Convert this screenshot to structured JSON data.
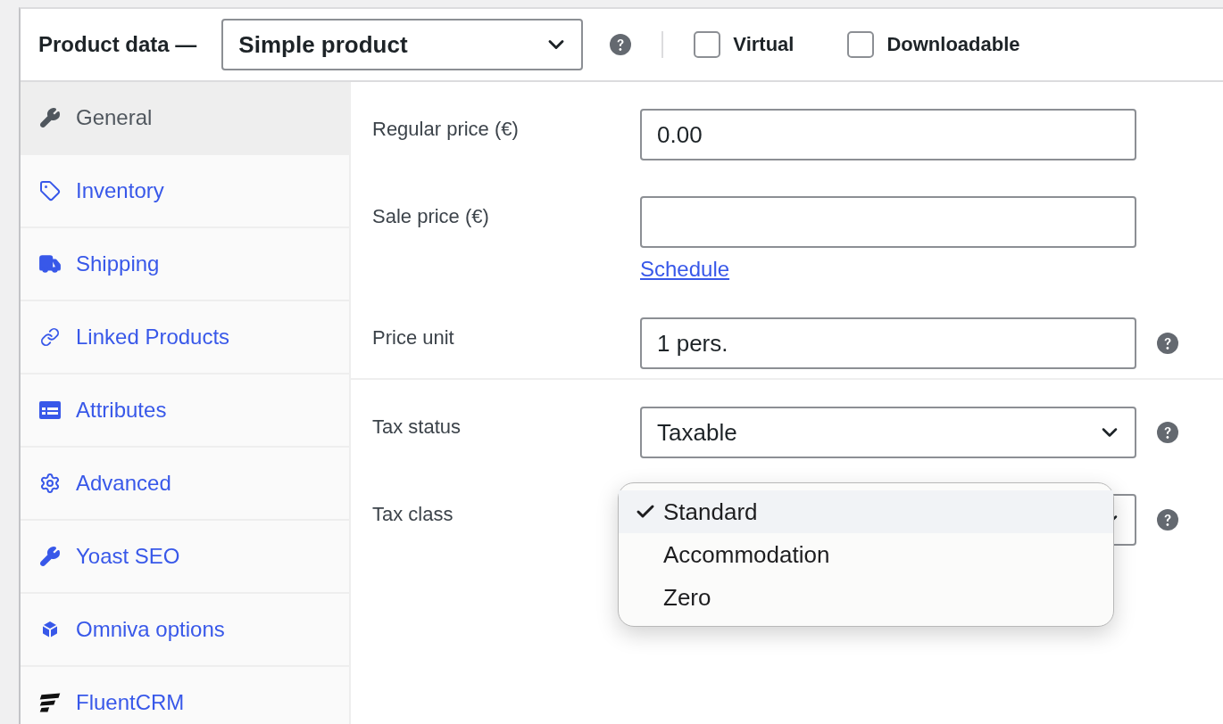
{
  "header": {
    "title": "Product data —",
    "product_type": "Simple product",
    "options": [
      {
        "label": "Virtual",
        "checked": false
      },
      {
        "label": "Downloadable",
        "checked": false
      }
    ]
  },
  "tabs": [
    {
      "label": "General",
      "selected": true
    },
    {
      "label": "Inventory",
      "selected": false
    },
    {
      "label": "Shipping",
      "selected": false
    },
    {
      "label": "Linked Products",
      "selected": false
    },
    {
      "label": "Attributes",
      "selected": false
    },
    {
      "label": "Advanced",
      "selected": false
    },
    {
      "label": "Yoast SEO",
      "selected": false
    },
    {
      "label": "Omniva options",
      "selected": false
    },
    {
      "label": "FluentCRM",
      "selected": false
    }
  ],
  "groups": [
    {
      "fields": [
        {
          "label": "Regular price (€)",
          "kind": "text",
          "value": "0.00",
          "help": false
        },
        {
          "label": "Sale price (€)",
          "kind": "text",
          "help": false,
          "link": "Schedule"
        },
        {
          "label": "Price unit",
          "kind": "text",
          "value": "1 pers.",
          "help": true
        }
      ]
    },
    {
      "fields": [
        {
          "label": "Tax status",
          "kind": "select",
          "value": "Taxable",
          "help": true
        },
        {
          "label": "Tax class",
          "kind": "select",
          "help": true,
          "menu": [
            {
              "label": "Standard",
              "selected": true
            },
            {
              "label": "Accommodation",
              "selected": false
            },
            {
              "label": "Zero",
              "selected": false
            }
          ]
        }
      ]
    }
  ]
}
